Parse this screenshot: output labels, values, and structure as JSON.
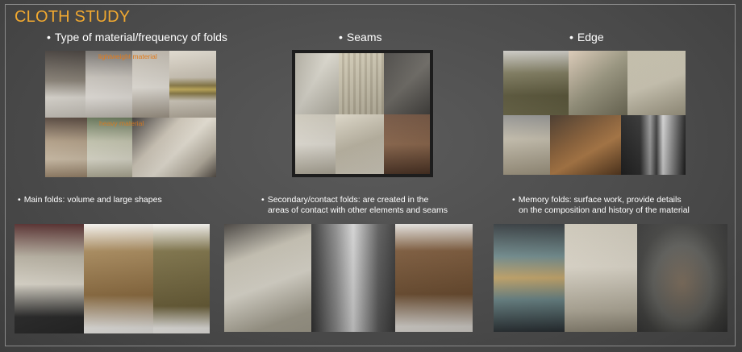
{
  "title": "CLOTH STUDY",
  "sections": {
    "material": {
      "heading": "Type of material/frequency of folds",
      "tag_light": "lightweight material",
      "tag_heavy": "heavy material"
    },
    "seams": {
      "heading": "Seams"
    },
    "edge": {
      "heading": "Edge"
    }
  },
  "captions": {
    "main": "Main folds: volume and large shapes",
    "secondary_line1": "Secondary/contact folds:  are created in the",
    "secondary_line2": "areas of contact with other elements and seams",
    "memory_line1": "Memory folds: surface work, provide details",
    "memory_line2": "on the composition and history of the material"
  },
  "bullet": "•",
  "colors": {
    "title": "#f0a830",
    "tag": "#e07a1a",
    "background": "#4a4a4a"
  }
}
